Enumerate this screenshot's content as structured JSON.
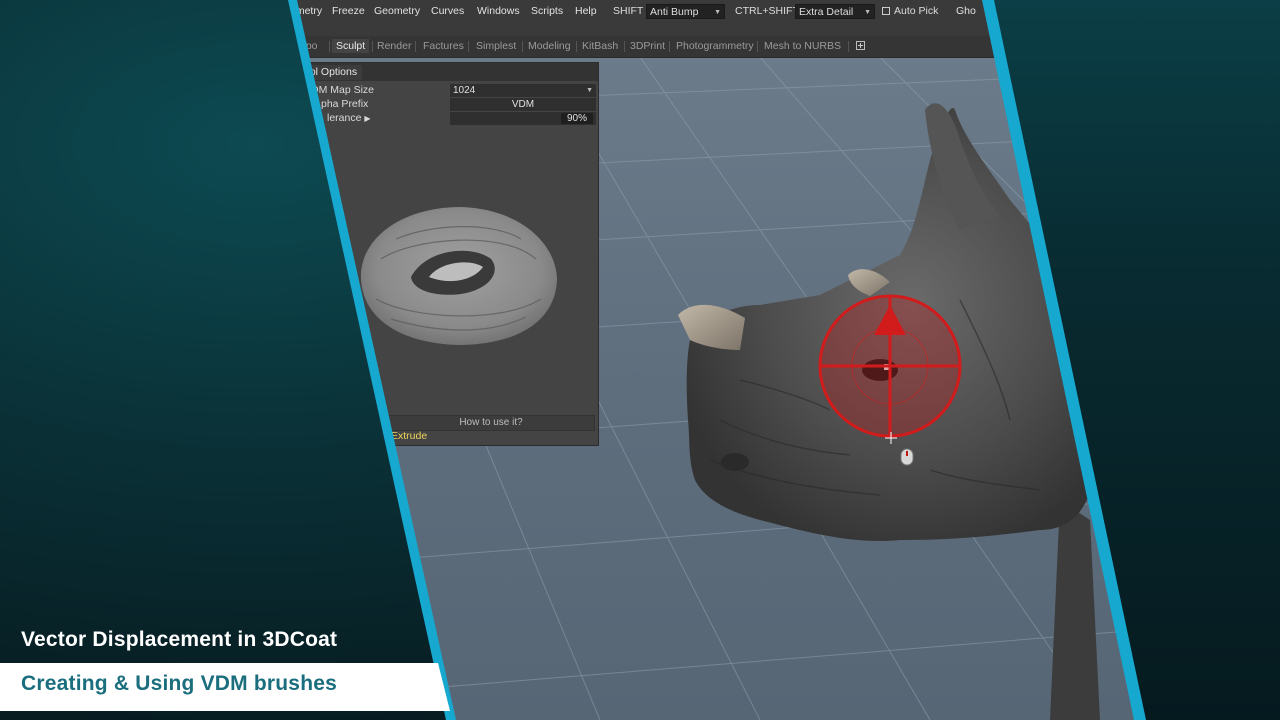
{
  "menubar": {
    "items": [
      "ometry",
      "Freeze",
      "Geometry",
      "Curves",
      "Windows",
      "Scripts",
      "Help"
    ],
    "shift_label": "SHIFT",
    "shift_value": "Anti Bump",
    "ctrl_shift_label": "CTRL+SHIFT",
    "ctrl_shift_value": "Extra Detail",
    "auto_pick_label": "Auto Pick",
    "ghost_label": "Gho"
  },
  "rooms": {
    "tabs": [
      "opo",
      "Sculpt",
      "Render",
      "Factures",
      "Simplest",
      "Modeling",
      "KitBash",
      "3DPrint",
      "Photogrammetry",
      "Mesh to NURBS"
    ],
    "active": "Sculpt"
  },
  "tool_options": {
    "tab_label": "ool Options",
    "vdm_map_size_label": "DM Map Size",
    "vdm_map_size_value": "1024",
    "alpha_prefix_label": "pha Prefix",
    "alpha_prefix_value": "VDM",
    "tolerance_label": "lerance",
    "tolerance_value": "90%",
    "how_to_label": "How to use it?",
    "mode_label": "Extrude"
  },
  "titles": {
    "main": "Vector Displacement in 3DCoat",
    "sub": "Creating & Using VDM brushes"
  },
  "colors": {
    "accent_stripe": "#17a8cf",
    "subtitle_text": "#1a6e7d",
    "highlight_text": "#f0d45a",
    "brush_ring": "#cc1f1f"
  }
}
